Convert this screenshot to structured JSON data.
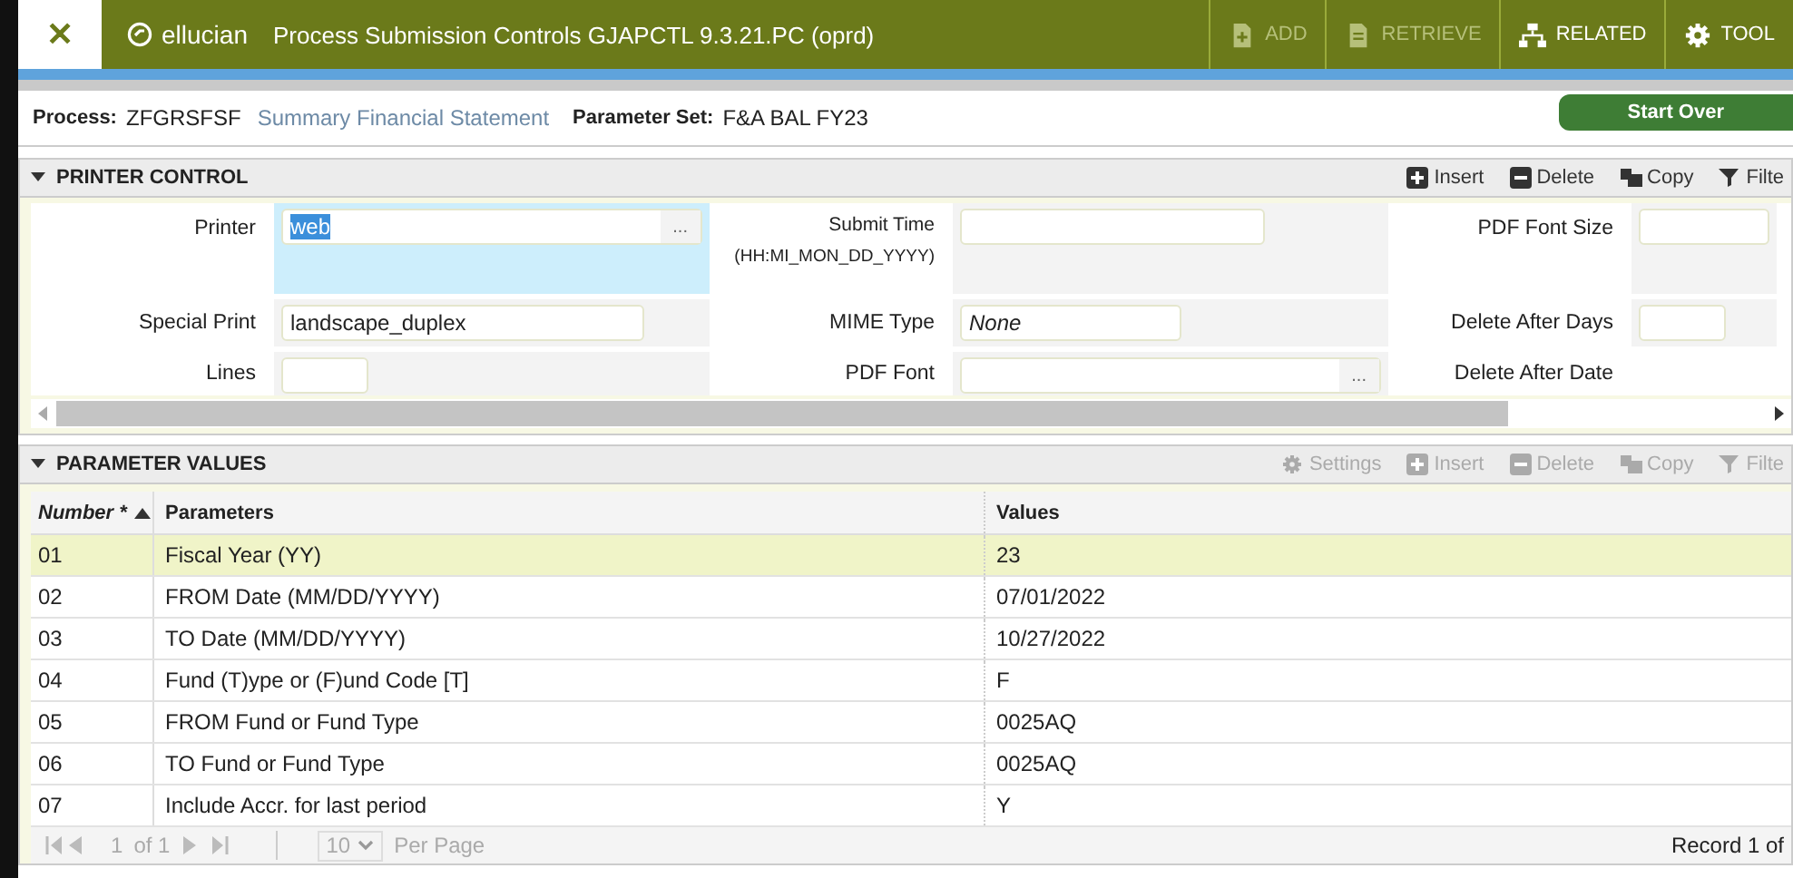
{
  "header": {
    "close": "✕",
    "brand": "ellucian",
    "title": "Process Submission Controls GJAPCTL 9.3.21.PC (oprd)",
    "actions": [
      {
        "label": "ADD",
        "disabled": true
      },
      {
        "label": "RETRIEVE",
        "disabled": true
      },
      {
        "label": "RELATED",
        "disabled": false
      },
      {
        "label": "TOOL",
        "disabled": false
      }
    ]
  },
  "process": {
    "process_label": "Process:",
    "process_code": "ZFGRSFSF",
    "process_name": "Summary Financial Statement",
    "param_label": "Parameter Set:",
    "param_value": "F&A BAL FY23",
    "start_over": "Start Over"
  },
  "printer_control": {
    "title": "PRINTER CONTROL",
    "tools": [
      {
        "label": "Insert",
        "disabled": false
      },
      {
        "label": "Delete",
        "disabled": false
      },
      {
        "label": "Copy",
        "disabled": false
      },
      {
        "label": "Filte",
        "disabled": false
      }
    ],
    "rows": [
      [
        {
          "label": "Printer",
          "field": {
            "value": "web",
            "focused": true,
            "lookup": "..."
          }
        },
        {
          "label": "Submit Time",
          "note": "(HH:MI_MON_DD_YYYY)",
          "field": {
            "focused": false
          }
        },
        {
          "label": "PDF Font Size",
          "field": {
            "focused": false
          }
        }
      ],
      [
        {
          "label": "Special Print",
          "field": {
            "value": "landscape_duplex",
            "focused": false
          }
        },
        {
          "label": "MIME Type",
          "field": {
            "placeholder": "None",
            "focused": false
          }
        },
        {
          "label": "Delete After Days",
          "field": {
            "focused": false
          }
        }
      ],
      [
        {
          "label": "Lines",
          "field": {
            "focused": false
          }
        },
        {
          "label": "PDF Font",
          "field": {
            "focused": false,
            "lookup": "..."
          }
        },
        {
          "label": "Delete After Date"
        }
      ]
    ]
  },
  "parameter_values": {
    "title": "PARAMETER VALUES",
    "tools": [
      {
        "label": "Settings",
        "disabled": true
      },
      {
        "label": "Insert",
        "disabled": true
      },
      {
        "label": "Delete",
        "disabled": true
      },
      {
        "label": "Copy",
        "disabled": true
      },
      {
        "label": "Filte",
        "disabled": true
      }
    ],
    "columns": [
      "Number *",
      "Parameters",
      "Values"
    ],
    "rows": [
      {
        "number": "01",
        "parameter": "Fiscal Year (YY)",
        "value": "23",
        "selected": true
      },
      {
        "number": "02",
        "parameter": "FROM Date (MM/DD/YYYY)",
        "value": "07/01/2022",
        "selected": false
      },
      {
        "number": "03",
        "parameter": "TO Date (MM/DD/YYYY)",
        "value": "10/27/2022",
        "selected": false
      },
      {
        "number": "04",
        "parameter": "Fund (T)ype or (F)und Code [T]",
        "value": "F",
        "selected": false
      },
      {
        "number": "05",
        "parameter": "FROM Fund or Fund Type",
        "value": "0025AQ",
        "selected": false
      },
      {
        "number": "06",
        "parameter": "TO Fund or Fund Type",
        "value": "0025AQ",
        "selected": false
      },
      {
        "number": "07",
        "parameter": "Include Accr. for last period",
        "value": "Y",
        "selected": false
      }
    ],
    "pager": {
      "page": "1",
      "of": "of 1",
      "per_page": "10",
      "per_page_label": "Per Page",
      "record": "Record 1 of"
    }
  }
}
